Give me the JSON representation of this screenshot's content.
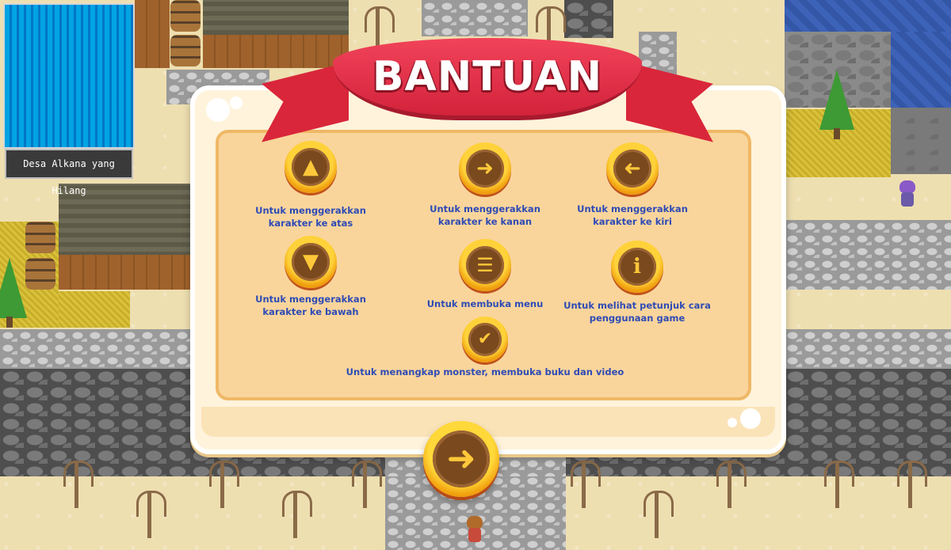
{
  "map": {
    "location_name": "Desa Alkana yang Hilang"
  },
  "dialog": {
    "title": "BANTUAN",
    "items": [
      {
        "icon": "arrow-up-icon",
        "text": "Untuk menggerakkan karakter ke atas"
      },
      {
        "icon": "arrow-right-icon",
        "text": "Untuk menggerakkan karakter ke kanan"
      },
      {
        "icon": "arrow-left-icon",
        "text": "Untuk menggerakkan karakter ke kiri"
      },
      {
        "icon": "arrow-down-icon",
        "text": "Untuk menggerakkan karakter ke bawah"
      },
      {
        "icon": "menu-icon",
        "text": "Untuk membuka menu"
      },
      {
        "icon": "info-icon",
        "text": "Untuk melihat petunjuk cara penggunaan game"
      },
      {
        "icon": "checkmark-icon",
        "text": "Untuk menangkap monster, membuka buku dan video"
      }
    ],
    "next_button_icon": "arrow-right-icon"
  },
  "colors": {
    "ribbon": "#d9263a",
    "help_text": "#2f4bb5",
    "button_gold": "#ffd23a",
    "button_face": "#7a4a1e"
  }
}
